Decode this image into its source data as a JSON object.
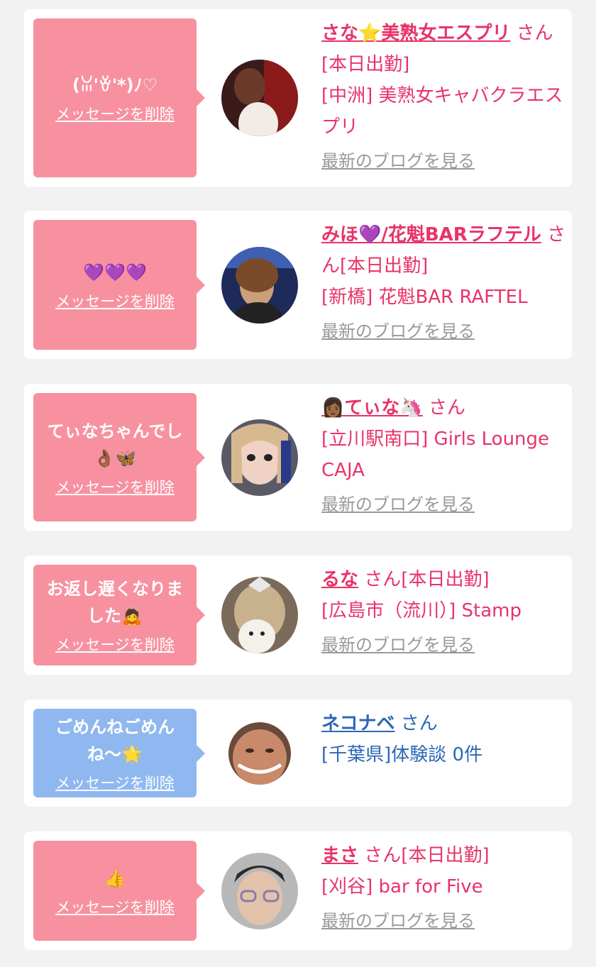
{
  "delete_label": "メッセージを削除",
  "blog_label": "最新のブログを見る",
  "colors": {
    "pink": "#f7919f",
    "blue": "#8fb8f0",
    "name_pink": "#e8336a",
    "name_blue": "#2b67b8"
  },
  "messages": [
    {
      "message": "(ꈍ'ꈊ'*)ﾉ♡",
      "name": "さな⭐美熟女エスプリ",
      "suffix": "さん",
      "status": "[本日出勤]",
      "shop": "[中洲] 美熟女キャバクラエスプリ",
      "avatar_icon": "profile-photo"
    },
    {
      "message": "💜💜💜",
      "name": "みほ💜/花魁BARラフテル",
      "suffix": "さん",
      "status": "[本日出勤]",
      "shop": "[新橋] 花魁BAR RAFTEL",
      "avatar_icon": "profile-photo"
    },
    {
      "message": "てぃなちゃんでし👌🏾🦋",
      "name": "👩🏾てぃな🦄",
      "suffix": "さん",
      "status": "",
      "shop": "[立川駅南口] Girls Lounge CAJA",
      "avatar_icon": "profile-photo"
    },
    {
      "message": "お返し遅くなりました🙇",
      "name": "るな",
      "suffix": "さん",
      "status": "[本日出勤]",
      "shop": "[広島市（流川）] Stamp",
      "avatar_icon": "profile-photo"
    },
    {
      "message": "ごめんねごめんね〜🌟",
      "name": "ネコナベ",
      "suffix": "さん",
      "status": "",
      "shop": "[千葉県]体験談 0件",
      "avatar_icon": "profile-photo"
    },
    {
      "message": "👍",
      "name": "まさ",
      "suffix": "さん",
      "status": "[本日出勤]",
      "shop": "[刈谷] bar for Five",
      "avatar_icon": "profile-photo"
    }
  ]
}
